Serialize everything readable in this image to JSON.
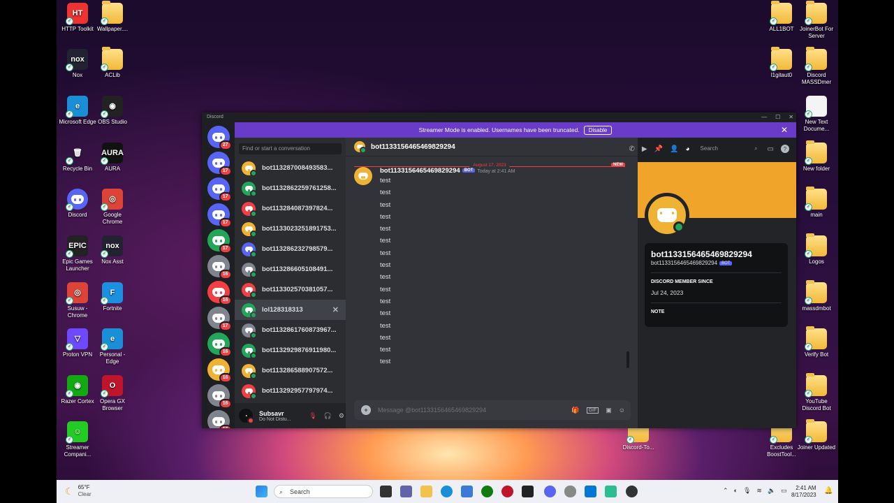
{
  "desktop": {
    "left_icons": [
      {
        "label": "HTTP Toolkit",
        "glyph": "HT",
        "color": "#e33"
      },
      {
        "label": "Wallpaper....",
        "glyph": "",
        "color": "folder"
      },
      {
        "label": "Nox",
        "glyph": "nox",
        "color": "#223"
      },
      {
        "label": "ACLib",
        "glyph": "",
        "color": "folder"
      },
      {
        "label": "Microsoft Edge",
        "glyph": "e",
        "color": "#1a8fd8"
      },
      {
        "label": "OBS Studio",
        "glyph": "◉",
        "color": "#222"
      },
      {
        "label": "Recycle Bin",
        "glyph": "🗑",
        "color": "transparent"
      },
      {
        "label": "AURA",
        "glyph": "AURA",
        "color": "#111"
      },
      {
        "label": "Discord",
        "glyph": "",
        "color": "#5865f2"
      },
      {
        "label": "Google Chrome",
        "glyph": "◎",
        "color": "#db4437"
      },
      {
        "label": "Epic Games Launcher",
        "glyph": "EPIC",
        "color": "#222"
      },
      {
        "label": "Nox Asst",
        "glyph": "nox",
        "color": "#223"
      },
      {
        "label": "Susuw - Chrome",
        "glyph": "◎",
        "color": "#db4437"
      },
      {
        "label": "Fortnite",
        "glyph": "F",
        "color": "#1b8fe0"
      },
      {
        "label": "Proton VPN",
        "glyph": "▽",
        "color": "#6d4aff"
      },
      {
        "label": "Personal - Edge",
        "glyph": "e",
        "color": "#1a8fd8"
      },
      {
        "label": "Razer Cortex",
        "glyph": "◉",
        "color": "#1a1"
      },
      {
        "label": "Opera GX Browser",
        "glyph": "O",
        "color": "#c0142b"
      },
      {
        "label": "Streamer Compani...",
        "glyph": "☺",
        "color": "#2c2"
      }
    ],
    "right_icons": [
      {
        "label": "ALL1BOT"
      },
      {
        "label": "JoinerBot For Server"
      },
      {
        "label": "l1gitaut0"
      },
      {
        "label": "Discord MASSDmer"
      },
      {
        "label": "New Text Docume..."
      },
      {
        "label": "New folder"
      },
      {
        "label": "main"
      },
      {
        "label": "Logos"
      },
      {
        "label": "massdmbot"
      },
      {
        "label": "Verify Bot"
      },
      {
        "label": "YouTube Discord Bot"
      },
      {
        "label": "Discord-To..."
      },
      {
        "label": "Excludes BoostTool..."
      },
      {
        "label": "Joiner Updated"
      }
    ]
  },
  "window": {
    "title": "Discord"
  },
  "guilds": [
    "27",
    "17",
    "17",
    "17",
    "17",
    "16",
    "16",
    "17",
    "16",
    "16",
    "16",
    "16"
  ],
  "banner": {
    "text": "Streamer Mode is enabled. Usernames have been truncated.",
    "button": "Disable"
  },
  "dm_list": {
    "search_placeholder": "Find or start a conversation",
    "items": [
      {
        "name": "bot113287008493583...",
        "color": "#f0b232"
      },
      {
        "name": "bot113286225976125​8...",
        "color": "#23a55a"
      },
      {
        "name": "bot113284087397824...",
        "color": "#f23f43"
      },
      {
        "name": "bot113302325189175​3...",
        "color": "#f0b232"
      },
      {
        "name": "bot113286232798579...",
        "color": "#5865f2"
      },
      {
        "name": "bot113286605108491...",
        "color": "#80848e"
      },
      {
        "name": "bot113302570381057...",
        "color": "#f23f43"
      },
      {
        "name": "lol128318313",
        "color": "#23a55a"
      },
      {
        "name": "bot113286176087396​7...",
        "color": "#80848e"
      },
      {
        "name": "bot113292987691198​0...",
        "color": "#23a55a"
      },
      {
        "name": "bot113286588907572...",
        "color": "#f0b232"
      },
      {
        "name": "bot113292957797974...",
        "color": "#f23f43"
      }
    ]
  },
  "user": {
    "name": "Subsavr",
    "status": "Do Not Distu..."
  },
  "chat": {
    "channel": "bot1133156465469829294",
    "search": "Search",
    "date_divider": "August 17, 2023",
    "new_badge": "NEW",
    "author": "bot1133156465469829294",
    "bot_tag": "BOT",
    "timestamp": "Today at 2:41 AM",
    "messages": [
      "test",
      "test",
      "test",
      "test",
      "test",
      "test",
      "test",
      "test",
      "test",
      "test",
      "test",
      "test",
      "test",
      "test",
      "test",
      "test"
    ],
    "composer_placeholder": "Message @bot1133156465469829294"
  },
  "profile": {
    "name": "bot1133156465469829294",
    "username": "bot1133156465469829294",
    "bot_tag": "BOT",
    "member_since_label": "DISCORD MEMBER SINCE",
    "member_since": "Jul 24, 2023",
    "note_label": "NOTE"
  },
  "taskbar": {
    "weather_temp": "65°F",
    "weather_text": "Clear",
    "search": "Search",
    "time": "2:41 AM",
    "date": "8/17/2023"
  }
}
